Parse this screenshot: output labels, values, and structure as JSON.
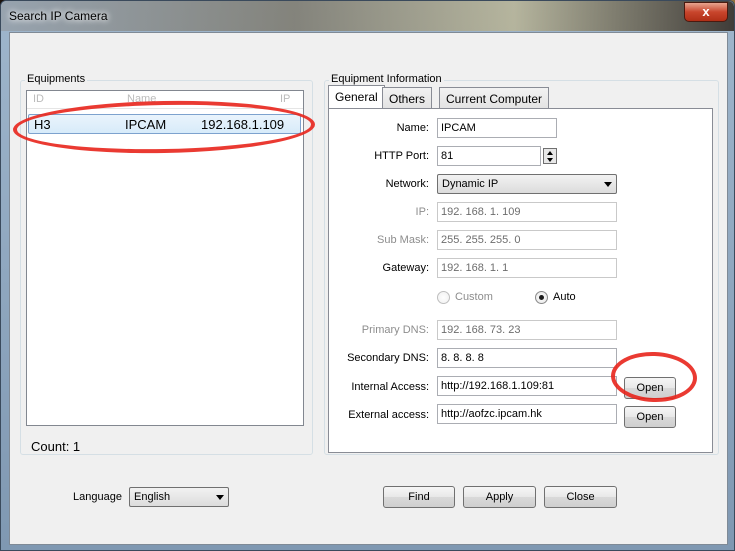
{
  "window": {
    "title": "Search IP Camera",
    "close_glyph": "x"
  },
  "equipments": {
    "group_label": "Equipments",
    "columns": [
      "ID",
      "Name",
      "IP"
    ],
    "rows": [
      {
        "id": "H3",
        "name": "IPCAM",
        "ip": "192.168.1.109"
      }
    ],
    "count_text": "Count: 1"
  },
  "info": {
    "group_label": "Equipment Information",
    "tabs": [
      "General",
      "Others",
      "Current Computer"
    ],
    "active_tab": "General",
    "fields": {
      "name_label": "Name:",
      "name_value": "IPCAM",
      "http_port_label": "HTTP Port:",
      "http_port_value": "81",
      "network_label": "Network:",
      "network_value": "Dynamic IP",
      "ip_label": "IP:",
      "ip_value": "192. 168. 1. 109",
      "submask_label": "Sub Mask:",
      "submask_value": "255. 255. 255. 0",
      "gateway_label": "Gateway:",
      "gateway_value": "192. 168. 1. 1",
      "dns_custom_label": "Custom",
      "dns_auto_label": "Auto",
      "dns_mode": "Auto",
      "primary_dns_label": "Primary DNS:",
      "primary_dns_value": "192. 168. 73. 23",
      "secondary_dns_label": "Secondary DNS:",
      "secondary_dns_value": "8. 8. 8. 8",
      "internal_access_label": "Internal Access:",
      "internal_access_value": "http://192.168.1.109:81",
      "external_access_label": "External access:",
      "external_access_value": "http://aofzc.ipcam.hk"
    },
    "open_internal_label": "Open",
    "open_external_label": "Open"
  },
  "footer": {
    "language_label": "Language",
    "language_value": "English",
    "find_label": "Find",
    "apply_label": "Apply",
    "close_label": "Close"
  },
  "colors": {
    "annotation": "#e8251c",
    "selection": "#d7ebfa",
    "close_button": "#c8452c"
  }
}
